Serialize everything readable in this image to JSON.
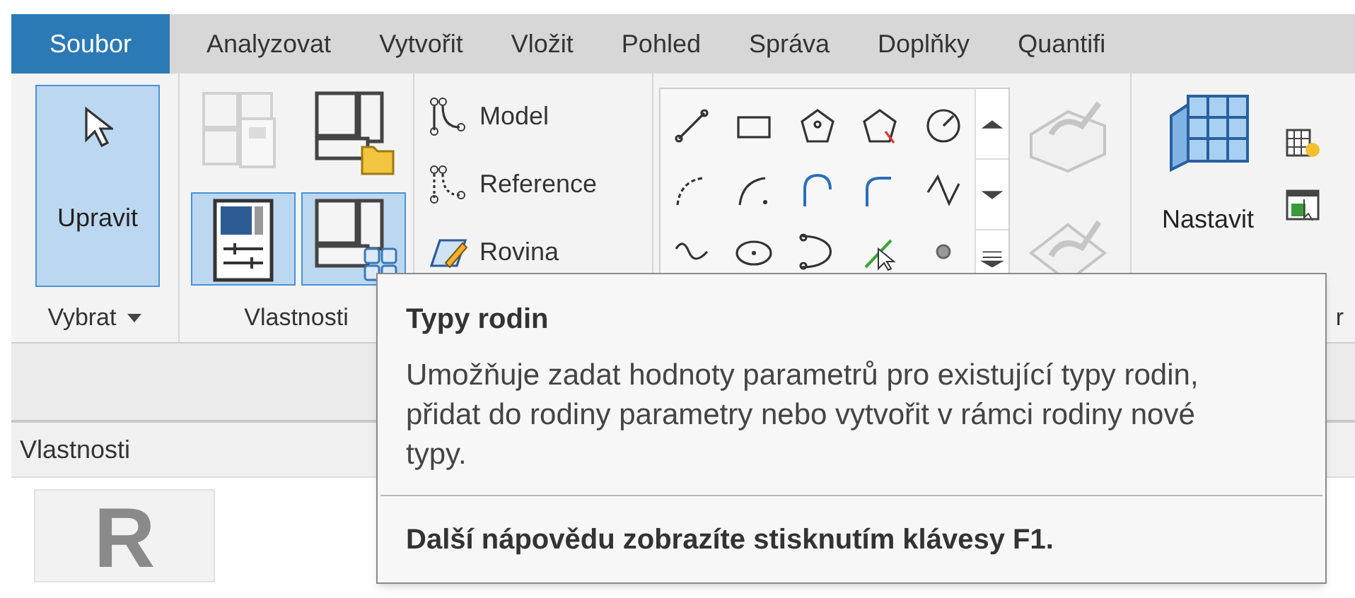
{
  "tabs": [
    {
      "label": "Soubor",
      "kind": "file"
    },
    {
      "label": "Analyzovat",
      "kind": "tab"
    },
    {
      "label": "Vytvořit",
      "kind": "tab"
    },
    {
      "label": "Vložit",
      "kind": "tab"
    },
    {
      "label": "Pohled",
      "kind": "tab"
    },
    {
      "label": "Správa",
      "kind": "tab"
    },
    {
      "label": "Doplňky",
      "kind": "tab"
    },
    {
      "label": "Quantifi",
      "kind": "tab"
    }
  ],
  "select_panel": {
    "button": {
      "label": "Upravit",
      "selected": true
    },
    "label": "Vybrat"
  },
  "properties_panel": {
    "buttons": [
      {
        "selected": false,
        "disabled": true
      },
      {
        "selected": false,
        "disabled": false
      },
      {
        "selected": true,
        "disabled": false
      },
      {
        "selected": true,
        "disabled": false
      }
    ],
    "label": "Vlastnosti"
  },
  "datum_panel": {
    "items": [
      {
        "label": "Model"
      },
      {
        "label": "Reference"
      },
      {
        "label": "Rovina"
      }
    ]
  },
  "settings_panel": {
    "button": {
      "label": "Nastavit"
    },
    "label": "r"
  },
  "tooltip": {
    "title": "Typy rodin",
    "description": "Umožňuje zadat hodnoty parametrů pro existující typy rodin, přidat do rodiny parametry nebo vytvořit v rámci rodiny nové typy.",
    "footer": "Další nápovědu zobrazíte stisknutím klávesy F1."
  },
  "properties_palette": {
    "title": "Vlastnosti",
    "logo_letter": "R"
  }
}
